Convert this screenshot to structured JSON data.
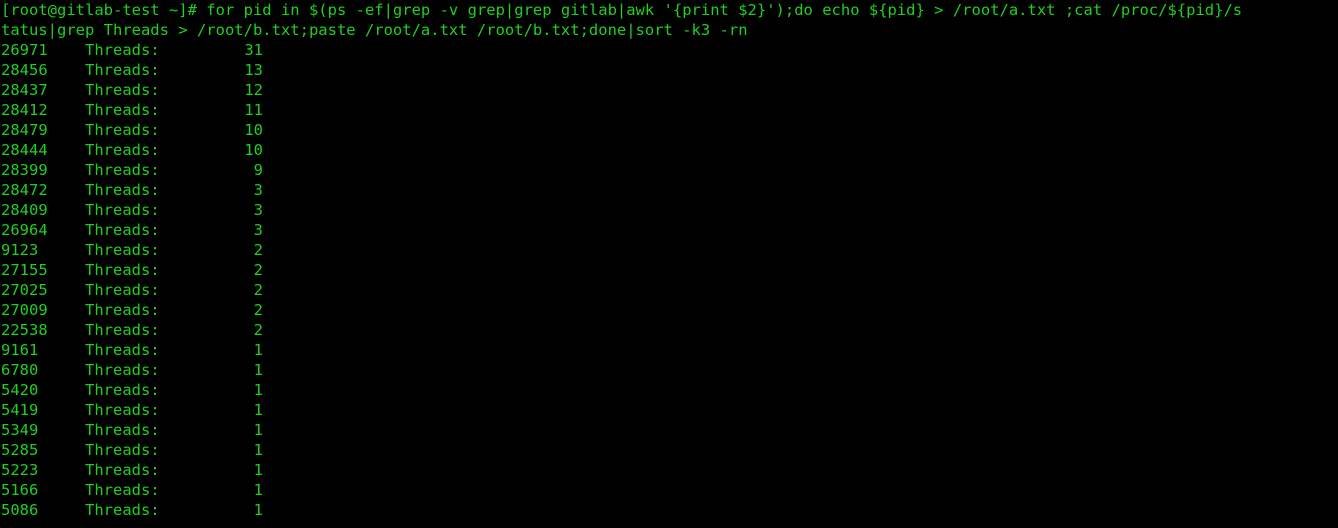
{
  "terminal": {
    "colors": {
      "background": "#000000",
      "foreground": "#1ed11e"
    },
    "prompt": "[root@gitlab-test ~]# ",
    "command_wrapped_line_1": "[root@gitlab-test ~]# for pid in $(ps -ef|grep -v grep|grep gitlab|awk '{print $2}');do echo ${pid} > /root/a.txt ;cat /proc/${pid}/s",
    "command_wrapped_line_2": "tatus|grep Threads > /root/b.txt;paste /root/a.txt /root/b.txt;done|sort -k3 -rn",
    "command_full": "for pid in $(ps -ef|grep -v grep|grep gitlab|awk '{print $2}');do echo ${pid} > /root/a.txt ;cat /proc/${pid}/status|grep Threads > /root/b.txt;paste /root/a.txt /root/b.txt;done|sort -k3 -rn",
    "label": "Threads:",
    "rows": [
      {
        "pid": "26971",
        "label": "Threads:",
        "count": "31"
      },
      {
        "pid": "28456",
        "label": "Threads:",
        "count": "13"
      },
      {
        "pid": "28437",
        "label": "Threads:",
        "count": "12"
      },
      {
        "pid": "28412",
        "label": "Threads:",
        "count": "11"
      },
      {
        "pid": "28479",
        "label": "Threads:",
        "count": "10"
      },
      {
        "pid": "28444",
        "label": "Threads:",
        "count": "10"
      },
      {
        "pid": "28399",
        "label": "Threads:",
        "count": "9"
      },
      {
        "pid": "28472",
        "label": "Threads:",
        "count": "3"
      },
      {
        "pid": "28409",
        "label": "Threads:",
        "count": "3"
      },
      {
        "pid": "26964",
        "label": "Threads:",
        "count": "3"
      },
      {
        "pid": "9123",
        "label": "Threads:",
        "count": "2"
      },
      {
        "pid": "27155",
        "label": "Threads:",
        "count": "2"
      },
      {
        "pid": "27025",
        "label": "Threads:",
        "count": "2"
      },
      {
        "pid": "27009",
        "label": "Threads:",
        "count": "2"
      },
      {
        "pid": "22538",
        "label": "Threads:",
        "count": "2"
      },
      {
        "pid": "9161",
        "label": "Threads:",
        "count": "1"
      },
      {
        "pid": "6780",
        "label": "Threads:",
        "count": "1"
      },
      {
        "pid": "5420",
        "label": "Threads:",
        "count": "1"
      },
      {
        "pid": "5419",
        "label": "Threads:",
        "count": "1"
      },
      {
        "pid": "5349",
        "label": "Threads:",
        "count": "1"
      },
      {
        "pid": "5285",
        "label": "Threads:",
        "count": "1"
      },
      {
        "pid": "5223",
        "label": "Threads:",
        "count": "1"
      },
      {
        "pid": "5166",
        "label": "Threads:",
        "count": "1"
      },
      {
        "pid": "5086",
        "label": "Threads:",
        "count": "1"
      }
    ]
  }
}
